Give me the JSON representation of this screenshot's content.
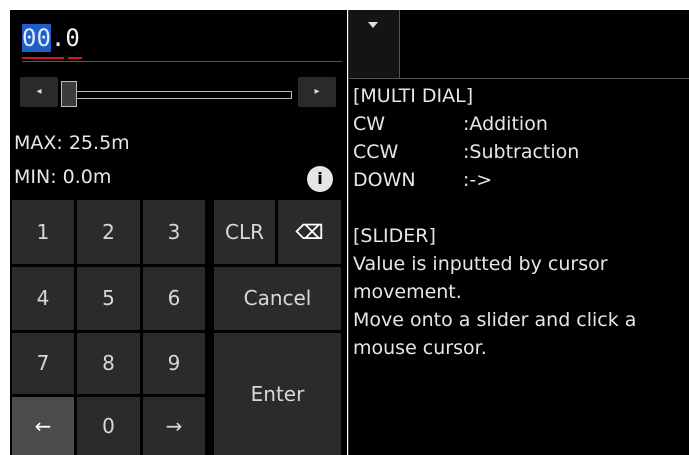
{
  "value": {
    "selected": "00",
    "rest": ".0"
  },
  "range": {
    "max": "MAX: 25.5m",
    "min": "MIN: 0.0m"
  },
  "slider": {
    "left_symbol": "◂",
    "right_symbol": "▸",
    "level": 0.0
  },
  "info": {
    "symbol": "i"
  },
  "keypad": {
    "digits": [
      "1",
      "2",
      "3",
      "4",
      "5",
      "6",
      "7",
      "8",
      "9",
      "0"
    ],
    "clr": "CLR",
    "backspace": "⌫",
    "cancel": "Cancel",
    "enter": "Enter",
    "left_arrow": "←",
    "right_arrow": "→"
  },
  "help": {
    "multi_dial_title": "[MULTI DIAL]",
    "cw_key": "CW",
    "cw_val": ":Addition",
    "ccw_key": "CCW",
    "ccw_val": ":Subtraction",
    "down_key": "DOWN",
    "down_val": ":->",
    "slider_title": "[SLIDER]",
    "slider_line1": "Value is inputted by cursor movement.",
    "slider_line2": "Move onto a slider and click a mouse cursor."
  },
  "colors": {
    "accent": "#d0142b",
    "selection": "#1f5ec6"
  },
  "icons": {
    "dropdown": "chevron-down-icon",
    "info": "info-icon",
    "backspace": "backspace-icon"
  }
}
